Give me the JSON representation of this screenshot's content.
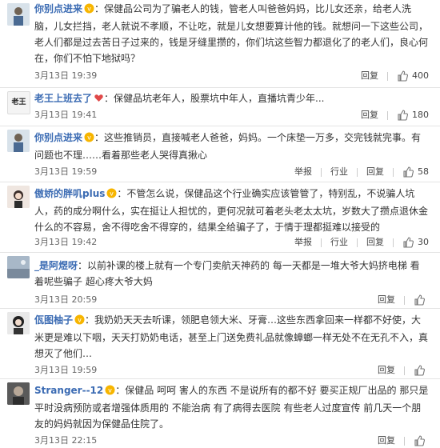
{
  "comments": [
    {
      "username": "你别点进来",
      "text": "：保健品公司为了骗老人的钱，管老人叫爸爸妈妈，比儿女还亲，给老人洗脑，儿女拦挡，老人就说不孝顺，不让吃，就是儿女想要算计他的钱。就想问一下这些公司，老人们都是过去苦日子过来的，钱是牙缝里攒的，你们坑这些智力都退化了的老人们，良心何在，你们不怕下地狱吗？",
      "time": "3月13日 19:39",
      "reply": "回复",
      "likes": "400"
    },
    {
      "username": "老王上班去了",
      "text": "：保健品坑老年人，股票坑中年人，直播坑青少年...",
      "time": "3月13日 19:41",
      "reply": "回复",
      "likes": "180",
      "avatar_text": "老王"
    },
    {
      "username": "你别点进来",
      "text": "：这些推销员，直接喊老人爸爸，妈妈。一个床垫一万多，交完钱就完事。有问题也不理……看着那些老人哭得真揪心",
      "time": "3月13日 19:59",
      "report": "举报",
      "moderate": "行业",
      "reply": "回复",
      "likes": "58"
    },
    {
      "username": "傲娇的胖叽plus",
      "text": "：不管怎么说，保健品这个行业确实应该管管了，特别乱，不说骗人坑人，药的成分啊什么，实在挺让人担忧的，更何况就可着老头老太太坑，岁数大了攒点退休金什么的不容易，舍不得吃舍不得穿的，结果全给骗子了，于情于理都挺难以接受的",
      "time": "3月13日 19:42",
      "report": "举报",
      "moderate": "行业",
      "reply": "回复",
      "likes": "30"
    },
    {
      "username": "_是阿煜呀",
      "text": "：以前补课的楼上就有一个专门卖航天神药的 每一天都是一堆大爷大妈挤电梯 看着呢些骗子 超心疼大爷大妈",
      "time": "3月13日 20:59",
      "reply": "回复",
      "likes": ""
    },
    {
      "username": "佤图柚子",
      "text": "：我奶奶天天去听课，领肥皂领大米、牙膏…这些东西拿回来一样都不好使，大米更是难以下咽，天天打奶奶电话，甚至上门送免费礼品就像蟑螂一样无处不在无孔不入，真想灭了他们…",
      "time": "3月13日 19:59",
      "reply": "回复",
      "likes": ""
    },
    {
      "username": "Stranger--12",
      "text": "：保健品 呵呵 害人的东西 不是说所有的都不好 要买正规厂出品的 那只是平时没病预防或者增强体质用的 不能治病 有了病得去医院 有些老人过度宣传 前几天一个朋友的妈妈就因为保健品住院了。",
      "time": "3月13日 22:15",
      "reply": "回复",
      "likes": ""
    }
  ],
  "colors": {
    "username": "#3b6bb3",
    "text": "#333333",
    "meta": "#666666",
    "divider": "#e4e4e4"
  }
}
